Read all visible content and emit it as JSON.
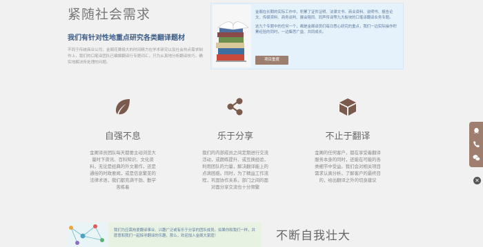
{
  "top": {
    "title": "紧随社会需求",
    "subtitle": "我们有针对性地重点研究各类翻译题材",
    "desc": "不同于传统商业公司，金阁花費极大的时间精力在学术研究以及社会热点需求制作上，我们的口笔译团队已编撰翻译行专题词汇，只为从真地分析翻译技巧，确实地解决所处理的问题。",
    "card_p1": "金阁在长期的实际工作中，积累了证件证明、法律文书、商业资料、说明书、报告论文、传媒资料、商务谈判、展会陪同、同声传译等九大板块的口笔译翻译业务专题。",
    "card_p2": "这九个专题中的任何一个，都是金阁译员们每日悉心研究的重点，我们一边实际操作积累经验的同时，一边集思广益、共同成长。",
    "card_button": "项目重度"
  },
  "features": [
    {
      "title": "自强不息",
      "desc": "金阁译员团队每天都要主动浏览大量时下资讯、百科知识、文化资料，无论是经典的外文著作，还是通俗的时政要闻，或是信息繁芜的法律术语，我们都充满干劲、勤学苦练着"
    },
    {
      "title": "乐于分享",
      "desc": "我们的内部成员之间定期进行交流活动，或朗练提升、或互换经验，利用团队的力量，解决翻译能上的点滴困惑。同时，为了精益工作流程，巩固协作关系，部门之间的面对面分享交流也十分频繁"
    },
    {
      "title": "不止于翻译",
      "desc": "金阁的任何客户，都在享受着翻译服务本身的同时，还能在可能的各类细节中受益。我们会对相关项目需求认真分析，了解客户的最终目的，给出翻译之外的切身建议"
    }
  ],
  "bottom": {
    "text": "我们为应需热爱翻译事业、兴趣广泛或有乐于分享的团队成员。如果你和我们一样，并愿意和我们一起探寻翻译的乐趣，那么，欢迎加入金阁大家庭！",
    "title": "不断自我壮大"
  },
  "side": {
    "close": "✕"
  },
  "colors": {
    "accent": "#9e7e6e",
    "link": "#3d5d86",
    "card_blue": "#e6f2fb",
    "card_green": "#e7f2e3"
  },
  "icons": [
    "leaf-icon",
    "share-icon",
    "box-icon",
    "qq-icon",
    "phone-icon",
    "wechat-icon",
    "close-icon"
  ]
}
